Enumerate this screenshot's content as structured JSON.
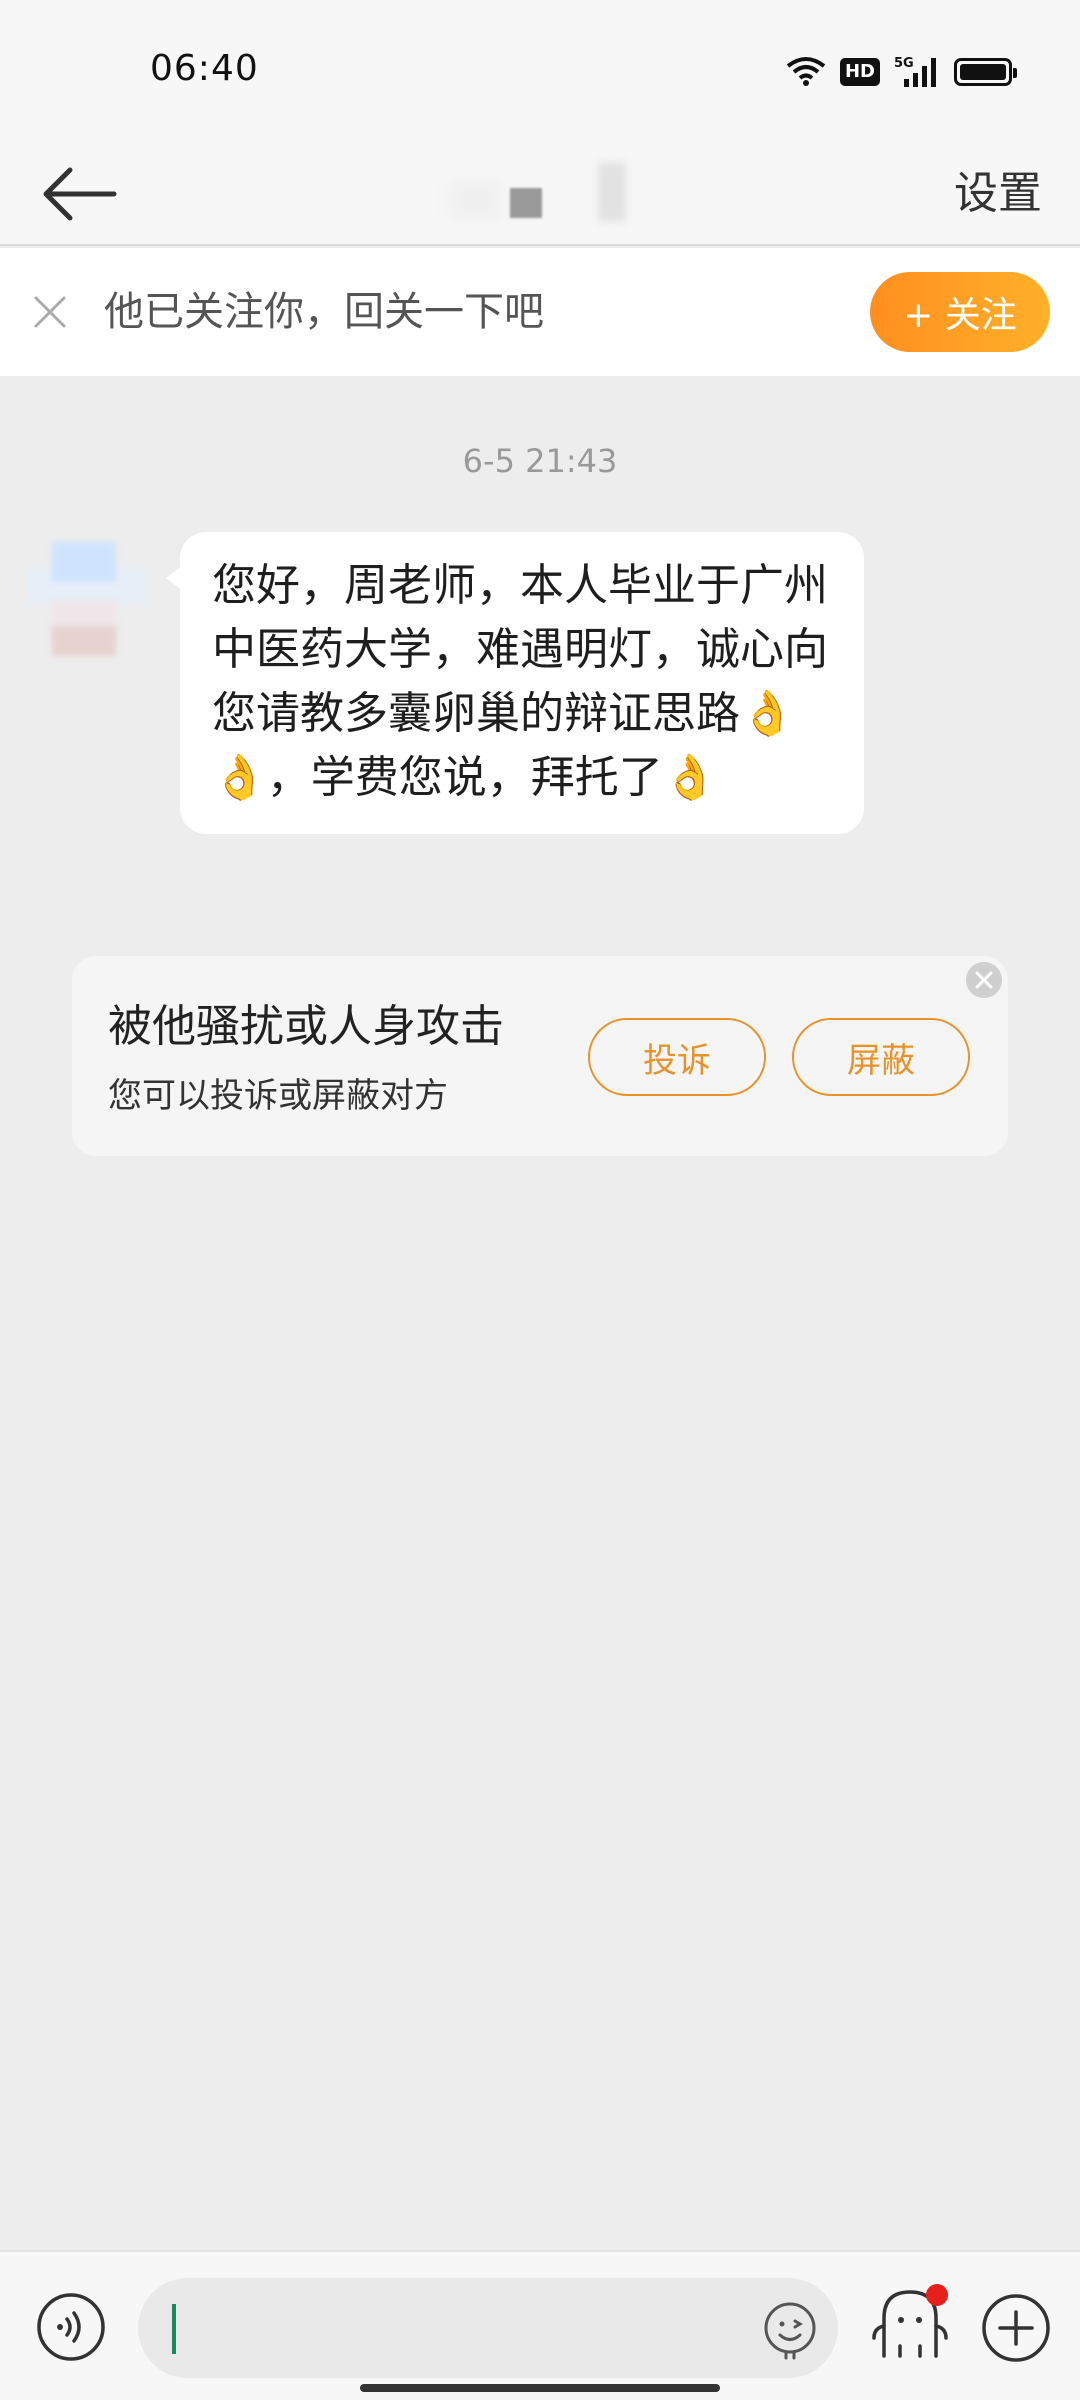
{
  "status_bar": {
    "time": "06:40",
    "hd_badge": "HD",
    "network": "5G"
  },
  "header": {
    "back_icon": "back-arrow-icon",
    "settings_label": "设置"
  },
  "follow_bar": {
    "text": "他已关注你，回关一下吧",
    "button_label": "+ 关注",
    "accent": "#ff9b22"
  },
  "chat": {
    "timestamp": "6-5 21:43",
    "message": "您好，周老师，本人毕业于广州中医药大学，难遇明灯，诚心向您请教多囊卵巢的辩证思路👌👌，学费您说，拜托了👌"
  },
  "report_card": {
    "title": "被他骚扰或人身攻击",
    "subtitle": "您可以投诉或屏蔽对方",
    "complain_label": "投诉",
    "block_label": "屏蔽",
    "accent": "#e8932a"
  },
  "bottom_bar": {
    "input_value": "",
    "voice_icon": "voice-icon",
    "emoji_icon": "emoji-icon",
    "mascot_icon": "mascot-icon",
    "plus_icon": "plus-icon"
  }
}
